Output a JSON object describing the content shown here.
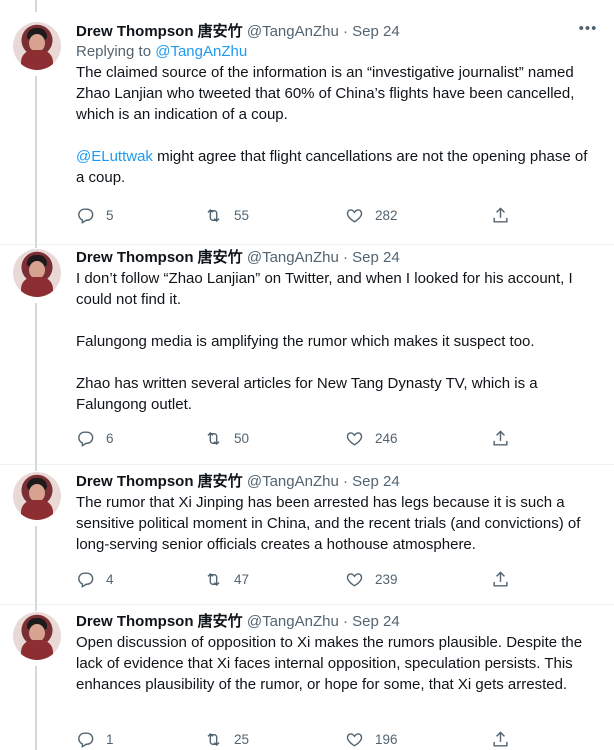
{
  "author": {
    "name": "Drew Thompson 唐安竹",
    "handle": "@TangAnZhu",
    "separator": "·"
  },
  "tweets": [
    {
      "date": "Sep 24",
      "replying_prefix": "Replying to ",
      "replying_to": "@TangAnZhu",
      "paragraphs": [
        "The claimed source of the information is an “investigative journalist” named Zhao Lanjian who tweeted that 60% of China’s flights have been cancelled, which is an indication of a coup."
      ],
      "mention": "@ELuttwak",
      "mention_text": " might agree that flight cancellations are not the opening phase of a coup.",
      "replies": "5",
      "retweets": "55",
      "likes": "282"
    },
    {
      "date": "Sep 24",
      "paragraphs": [
        "I don’t follow “Zhao Lanjian” on Twitter, and when I looked for his account, I could not find it.",
        "Falungong media is amplifying the rumor which makes it suspect too.",
        "Zhao has written several articles for New Tang Dynasty TV, which is a Falungong outlet."
      ],
      "replies": "6",
      "retweets": "50",
      "likes": "246"
    },
    {
      "date": "Sep 24",
      "paragraphs": [
        "The rumor that Xi Jinping has been arrested has legs because it is such a sensitive political moment in China, and the recent trials (and convictions) of long-serving senior officials creates a hothouse atmosphere."
      ],
      "replies": "4",
      "retweets": "47",
      "likes": "239"
    },
    {
      "date": "Sep 24",
      "paragraphs": [
        "Open discussion of opposition to Xi makes the rumors plausible. Despite the lack of evidence that Xi faces internal opposition, speculation persists. This enhances plausibility of the rumor, or hope for some, that Xi gets arrested."
      ],
      "replies": "1",
      "retweets": "25",
      "likes": "196"
    }
  ],
  "icons": {
    "reply": "reply-icon",
    "retweet": "retweet-icon",
    "like": "heart-icon",
    "share": "share-icon",
    "more": "more-icon"
  },
  "colors": {
    "link": "#1d9bf0",
    "secondary_text": "#536471",
    "thread_line": "#cfd9de"
  }
}
